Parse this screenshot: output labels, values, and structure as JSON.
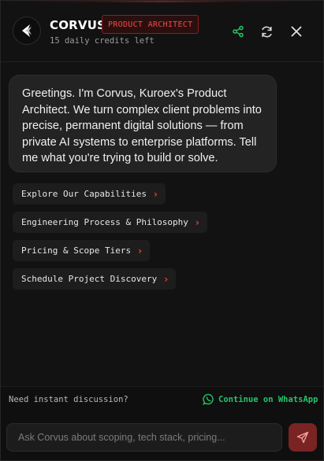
{
  "header": {
    "brand": "CORVUS",
    "role_badge": "PRODUCT ARCHITECT",
    "credits": "15 daily credits left",
    "icons": [
      "share-icon",
      "refresh-icon",
      "close-icon"
    ]
  },
  "message": {
    "text": "Greetings. I'm Corvus, Kuroex's Product Architect. We turn complex client problems into precise, permanent digital solutions — from private AI systems to enterprise platforms. Tell me what you're trying to build or solve."
  },
  "suggestions": [
    {
      "label": "Explore Our Capabilities"
    },
    {
      "label": "Engineering Process & Philosophy"
    },
    {
      "label": "Pricing & Scope Tiers"
    },
    {
      "label": "Schedule Project Discovery"
    }
  ],
  "footer": {
    "question": "Need instant discussion?",
    "whatsapp_label": "Continue on WhatsApp"
  },
  "composer": {
    "placeholder": "Ask Corvus about scoping, tech stack, pricing..."
  },
  "colors": {
    "accent_red": "#e0403f",
    "whatsapp_green": "#25c36a",
    "send_button": "#7a2323"
  }
}
